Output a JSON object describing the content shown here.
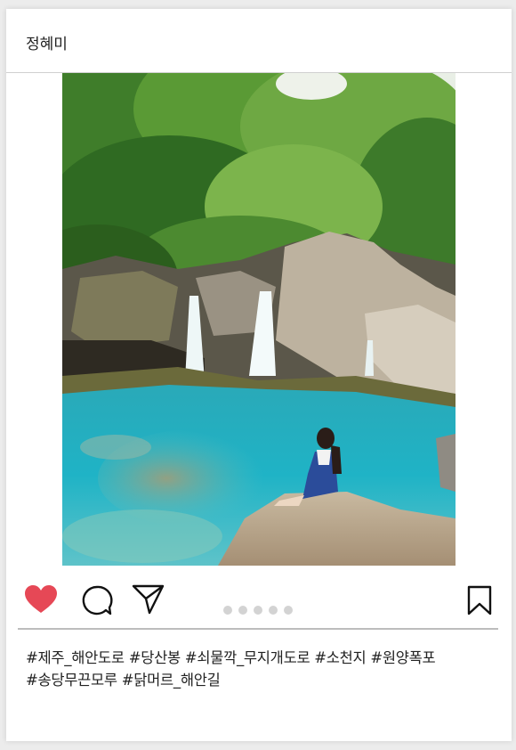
{
  "post": {
    "username": "정혜미",
    "photo": {
      "description_icon": "waterfall-pool-photo"
    },
    "actions": {
      "like_icon": "heart-filled-icon",
      "like_color": "#e64856",
      "comment_icon": "comment-bubble-icon",
      "share_icon": "paper-plane-icon",
      "save_icon": "bookmark-icon",
      "carousel_count": 5
    },
    "caption": {
      "line1": "#제주_해안도로 #당산봉 #쇠물깍_무지개도로 #소천지 #원양폭포",
      "line2": "#송당무끈모루 #닭머르_해안길"
    }
  }
}
